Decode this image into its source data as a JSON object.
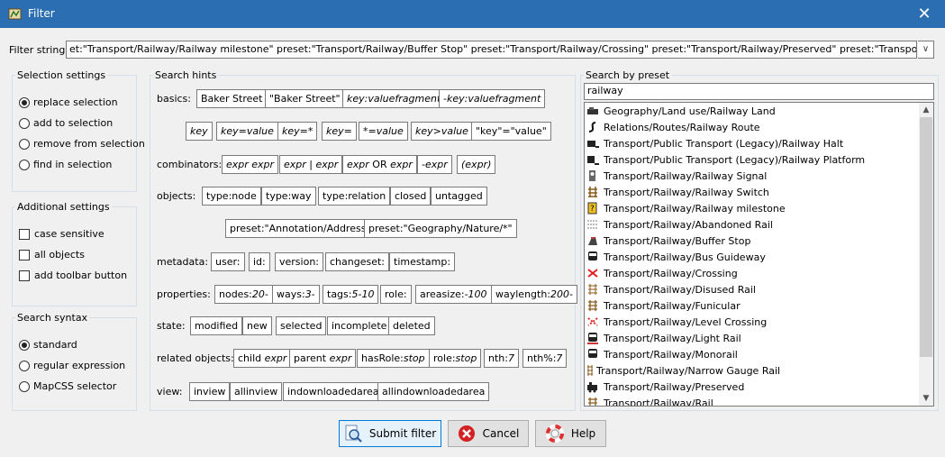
{
  "window": {
    "title": "Filter",
    "close_glyph": "✕",
    "app_icon": "josm-app-icon"
  },
  "filter_string": {
    "label": "Filter string:",
    "value": "et:\"Transport/Railway/Railway milestone\" preset:\"Transport/Railway/Buffer Stop\" preset:\"Transport/Railway/Crossing\" preset:\"Transport/Railway/Preserved\" preset:\"Transport/Railway/Turntable\"",
    "dropdown_glyph": "∨"
  },
  "selection_settings": {
    "title": "Selection settings",
    "options": [
      {
        "label": "replace selection",
        "selected": true
      },
      {
        "label": "add to selection",
        "selected": false
      },
      {
        "label": "remove from selection",
        "selected": false
      },
      {
        "label": "find in selection",
        "selected": false
      }
    ]
  },
  "additional_settings": {
    "title": "Additional settings",
    "options": [
      {
        "label": "case sensitive",
        "checked": false
      },
      {
        "label": "all objects",
        "checked": false
      },
      {
        "label": "add toolbar button",
        "checked": false
      }
    ]
  },
  "search_syntax": {
    "title": "Search syntax",
    "options": [
      {
        "label": "standard",
        "selected": true
      },
      {
        "label": "regular expression",
        "selected": false
      },
      {
        "label": "MapCSS selector",
        "selected": false
      }
    ]
  },
  "search_hints": {
    "title": "Search hints",
    "labels": {
      "basics": "basics:",
      "combinators": "combinators:",
      "objects": "objects:",
      "metadata": "metadata:",
      "properties": "properties:",
      "state": "state:",
      "related": "related objects:",
      "view": "view:"
    },
    "chips": {
      "b1": "Baker Street",
      "b2": "\"Baker Street\"",
      "b3": "key:valuefragment",
      "b4": "-key:valuefragment",
      "b5": "key",
      "b6": "key=value",
      "b7": "key=*",
      "b8": "key=",
      "b9": "*=value",
      "b10": "key>value",
      "b11": "\"key\"=\"value\"",
      "c1": "expr expr",
      "c2": "expr | expr",
      "c3a": "expr",
      "c3b": "OR",
      "c3c": "expr",
      "c4": "-expr",
      "c5": "(expr)",
      "o1": "type:node",
      "o2": "type:way",
      "o3": "type:relation",
      "o4": "closed",
      "o5": "untagged",
      "o6": "preset:\"Annotation/Address\"",
      "o7": "preset:\"Geography/Nature/*\"",
      "m1": "user:",
      "m2": "id:",
      "m3": "version:",
      "m4": "changeset:",
      "m5": "timestamp:",
      "p1a": "nodes:",
      "p1b": "20-",
      "p2a": "ways:",
      "p2b": "3-",
      "p3a": "tags:",
      "p3b": "5-10",
      "p4": "role:",
      "p5a": "areasize:",
      "p5b": "-100",
      "p6a": "waylength:",
      "p6b": "200-",
      "s1": "modified",
      "s2": "new",
      "s3": "selected",
      "s4": "incomplete",
      "s5": "deleted",
      "r1a": "child",
      "r1b": "expr",
      "r2a": "parent",
      "r2b": "expr",
      "r3a": "hasRole:",
      "r3b": "stop",
      "r4a": "role:",
      "r4b": "stop",
      "r5a": "nth:",
      "r5b": "7",
      "r6a": "nth%:",
      "r6b": "7",
      "v1": "inview",
      "v2": "allinview",
      "v3": "indownloadedarea",
      "v4": "allindownloadedarea"
    }
  },
  "preset_search": {
    "title": "Search by preset",
    "query": "railway",
    "items": [
      {
        "label": "Geography/Land use/Railway Land",
        "icon": "railway-land-icon"
      },
      {
        "label": "Relations/Routes/Railway Route",
        "icon": "railway-route-icon"
      },
      {
        "label": "Transport/Public Transport (Legacy)/Railway Halt",
        "icon": "railway-halt-icon"
      },
      {
        "label": "Transport/Public Transport (Legacy)/Railway Platform",
        "icon": "railway-platform-icon"
      },
      {
        "label": "Transport/Railway/Railway Signal",
        "icon": "railway-signal-icon"
      },
      {
        "label": "Transport/Railway/Railway Switch",
        "icon": "railway-switch-icon"
      },
      {
        "label": "Transport/Railway/Railway milestone",
        "icon": "milestone-icon"
      },
      {
        "label": "Transport/Railway/Abandoned Rail",
        "icon": "abandoned-rail-icon"
      },
      {
        "label": "Transport/Railway/Buffer Stop",
        "icon": "buffer-stop-icon"
      },
      {
        "label": "Transport/Railway/Bus Guideway",
        "icon": "bus-guideway-icon"
      },
      {
        "label": "Transport/Railway/Crossing",
        "icon": "crossing-icon"
      },
      {
        "label": "Transport/Railway/Disused Rail",
        "icon": "disused-rail-icon"
      },
      {
        "label": "Transport/Railway/Funicular",
        "icon": "funicular-icon"
      },
      {
        "label": "Transport/Railway/Level Crossing",
        "icon": "level-crossing-icon"
      },
      {
        "label": "Transport/Railway/Light Rail",
        "icon": "light-rail-icon"
      },
      {
        "label": "Transport/Railway/Monorail",
        "icon": "monorail-icon"
      },
      {
        "label": "Transport/Railway/Narrow Gauge Rail",
        "icon": "narrow-gauge-icon"
      },
      {
        "label": "Transport/Railway/Preserved",
        "icon": "preserved-icon"
      },
      {
        "label": "Transport/Railway/Rail",
        "icon": "rail-icon"
      }
    ]
  },
  "buttons": {
    "submit": {
      "label": "Submit filter",
      "icon": "search-filter-icon"
    },
    "cancel": {
      "label": "Cancel",
      "icon": "cancel-icon"
    },
    "help": {
      "label": "Help",
      "icon": "help-lifebuoy-icon"
    }
  },
  "colors": {
    "titlebar": "#2b6fb2",
    "primary_border": "#0078d7"
  }
}
